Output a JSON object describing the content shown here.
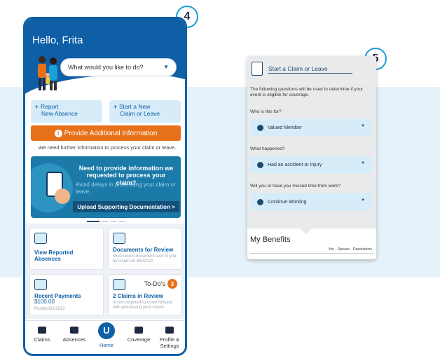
{
  "badges": {
    "phone": "4",
    "panel": "5"
  },
  "phone": {
    "greeting": "Hello, Frita",
    "search_placeholder": "What would you like to do?",
    "quick_actions": [
      {
        "label_line1": "Report",
        "label_line2": "New Absence"
      },
      {
        "label_line1": "Start a New",
        "label_line2": "Claim or Leave"
      }
    ],
    "alert_button": "Provide Additional Information",
    "alert_note": "We need further information to process your claim or leave.",
    "banner": {
      "title": "Need to provide information we requested to process your claim?",
      "text": "Avoid delays in processing your claim or leave.",
      "button": "Upload Supporting Documentation >"
    },
    "tiles": {
      "reported": {
        "title": "View Reported Absences"
      },
      "documents": {
        "title": "Documents for Review",
        "subtitle": "Most recent document sent to you by Unum on 8/5/2022"
      },
      "payments": {
        "title": "Recent Payments",
        "amount": "$100.00",
        "posted": "Posted 8/1/2022"
      },
      "todos": {
        "label": "To-Do's",
        "count": "3",
        "title": "2 Claims in Review",
        "subtitle": "Action required to move forward with processing your claims."
      }
    },
    "tabs": [
      {
        "label": "Claims",
        "icon": "claims-icon"
      },
      {
        "label": "Absences",
        "icon": "calendar-icon"
      },
      {
        "label": "Home",
        "icon": "home-logo-icon"
      },
      {
        "label": "Coverage",
        "icon": "coverage-icon"
      },
      {
        "label": "Profile & Settings",
        "icon": "menu-icon"
      }
    ],
    "accent_color": "#0e5fa6",
    "alert_color": "#e6711a"
  },
  "panel": {
    "title": "Start a Claim or Leave",
    "intro": "The following questions will be used to determine if your event is eligible for coverage.",
    "q1": "Who is this for?",
    "a1": "Valued Member",
    "q2": "What happened?",
    "a2": "Had an accident or injury",
    "q3": "Will you or have you missed time from work?",
    "a3": "Continue Working",
    "benefits_title": "My Benefits",
    "benefits_cols": [
      "You",
      "Spouse",
      "Dependents"
    ]
  }
}
